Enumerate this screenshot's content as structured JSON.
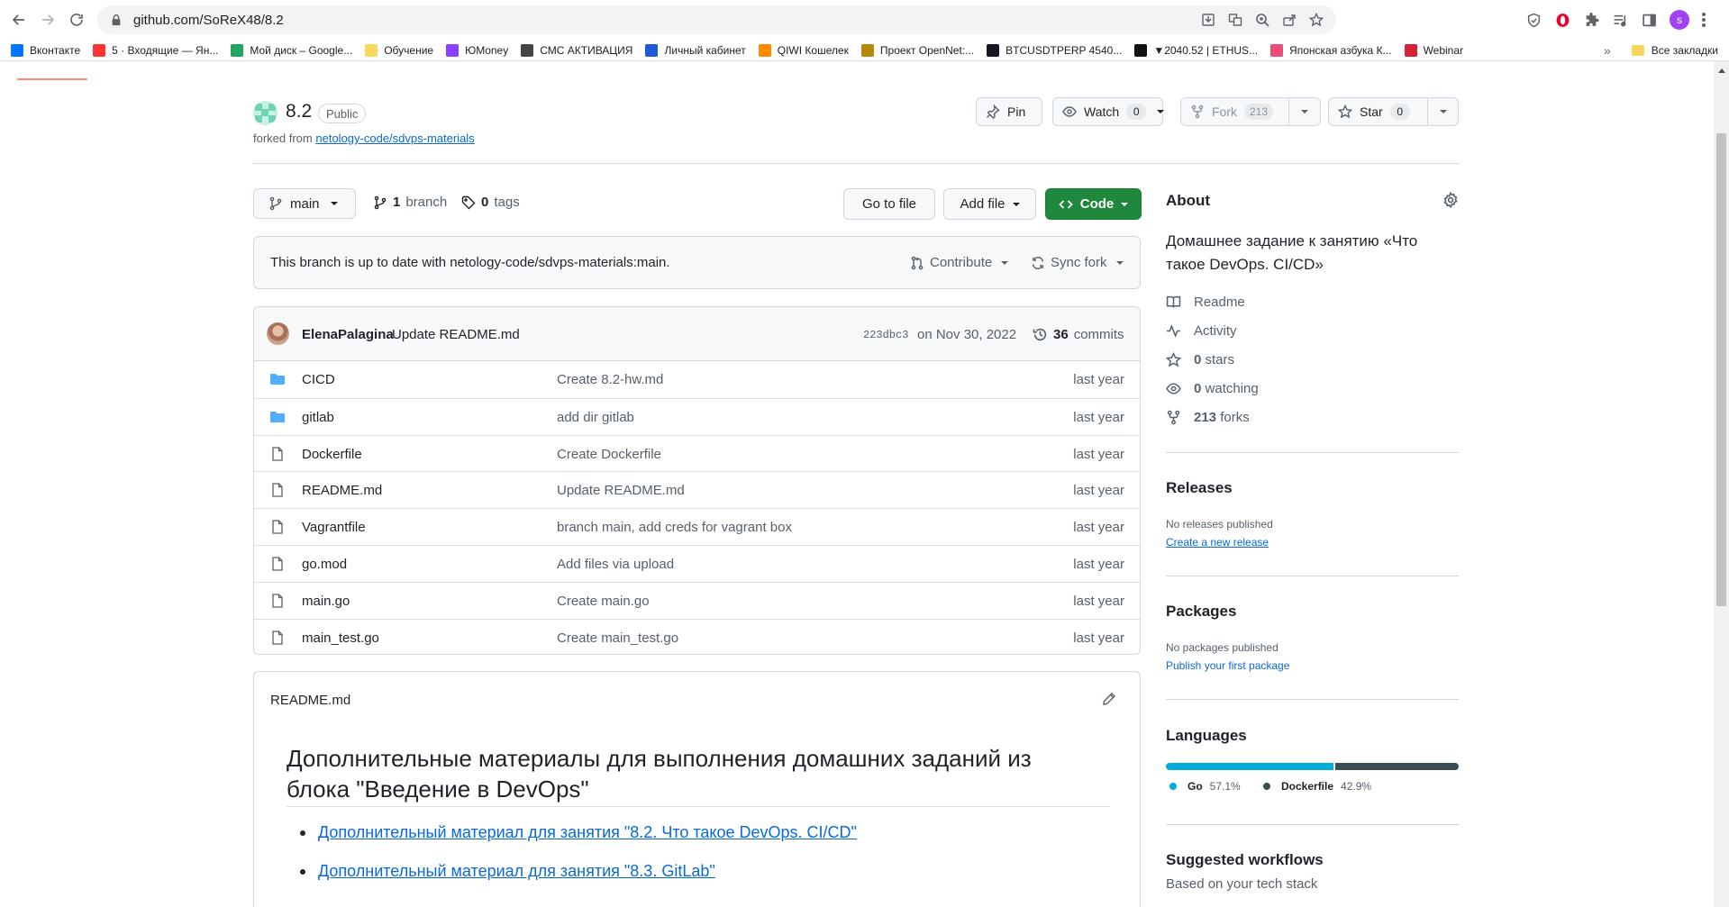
{
  "browser": {
    "url": "github.com/SoReX48/8.2",
    "profile_initial": "s",
    "bookmarks": [
      {
        "label": "Вконтакте",
        "color": "#0077ff"
      },
      {
        "label": "5 · Входящие — Ян...",
        "color": "#ff3333"
      },
      {
        "label": "Мой диск – Google...",
        "color": "#1fa463"
      },
      {
        "label": "Обучение",
        "color": "#f9d65c"
      },
      {
        "label": "ЮMoney",
        "color": "#8b3ffd"
      },
      {
        "label": "СМС АКТИВАЦИЯ",
        "color": "#444444"
      },
      {
        "label": "Личный кабинет",
        "color": "#1e5bd8"
      },
      {
        "label": "QIWI Кошелек",
        "color": "#ff8c00"
      },
      {
        "label": "Проект OpenNet:...",
        "color": "#b8860b"
      },
      {
        "label": "BTCUSDTPERP 4540...",
        "color": "#131722"
      },
      {
        "label": "▼2040.52 | ETHUS...",
        "color": "#111111"
      },
      {
        "label": "Японская азбука К...",
        "color": "#e94e77"
      },
      {
        "label": "Webinar",
        "color": "#d4203a"
      }
    ],
    "bookmarks_more": "»",
    "all_bookmarks": "Все закладки"
  },
  "repo": {
    "name": "8.2",
    "visibility": "Public",
    "forked_from_prefix": "forked from",
    "forked_from": "netology-code/sdvps-materials",
    "pin_label": "Pin",
    "watch_label": "Watch",
    "watch_count": "0",
    "fork_label": "Fork",
    "fork_count": "213",
    "star_label": "Star",
    "star_count": "0"
  },
  "filenav": {
    "branch": "main",
    "branches_count": "1",
    "branches_label": "branch",
    "tags_count": "0",
    "tags_label": "tags",
    "goto_file": "Go to file",
    "add_file": "Add file",
    "code": "Code"
  },
  "sync": {
    "message": "This branch is up to date with netology-code/sdvps-materials:main.",
    "contribute": "Contribute",
    "sync_fork": "Sync fork"
  },
  "latest_commit": {
    "author": "ElenaPalagina",
    "message": "Update README.md",
    "sha": "223dbc3",
    "date": "on Nov 30, 2022",
    "commits_count": "36",
    "commits_label": "commits"
  },
  "files": [
    {
      "name": "CICD",
      "type": "folder",
      "message": "Create 8.2-hw.md",
      "age": "last year"
    },
    {
      "name": "gitlab",
      "type": "folder",
      "message": "add dir gitlab",
      "age": "last year"
    },
    {
      "name": "Dockerfile",
      "type": "file",
      "message": "Create Dockerfile",
      "age": "last year"
    },
    {
      "name": "README.md",
      "type": "file",
      "message": "Update README.md",
      "age": "last year"
    },
    {
      "name": "Vagrantfile",
      "type": "file",
      "message": "branch main, add creds for vagrant box",
      "age": "last year"
    },
    {
      "name": "go.mod",
      "type": "file",
      "message": "Add files via upload",
      "age": "last year"
    },
    {
      "name": "main.go",
      "type": "file",
      "message": "Create main.go",
      "age": "last year"
    },
    {
      "name": "main_test.go",
      "type": "file",
      "message": "Create main_test.go",
      "age": "last year"
    }
  ],
  "readme": {
    "filename": "README.md",
    "heading": "Дополнительные материалы для выполнения домашних заданий из блока \"Введение в DevOps\"",
    "links": [
      "Дополнительный материал для занятия \"8.2. Что такое DevOps. CI/CD\"",
      "Дополнительный материал для занятия \"8.3. GitLab\""
    ]
  },
  "about": {
    "title": "About",
    "description": "Домашнее задание к занятию «Что такое DevOps. CI/CD»",
    "readme": "Readme",
    "activity": "Activity",
    "stars_count": "0",
    "stars_label": "stars",
    "watching_count": "0",
    "watching_label": "watching",
    "forks_count": "213",
    "forks_label": "forks"
  },
  "releases": {
    "title": "Releases",
    "empty": "No releases published",
    "create": "Create a new release"
  },
  "packages": {
    "title": "Packages",
    "empty": "No packages published",
    "publish": "Publish your first package"
  },
  "languages": {
    "title": "Languages",
    "items": [
      {
        "name": "Go",
        "percent": "57.1%",
        "share": 57.1,
        "color": "#00add8"
      },
      {
        "name": "Dockerfile",
        "percent": "42.9%",
        "share": 42.9,
        "color": "#384d54"
      }
    ]
  },
  "workflows": {
    "title": "Suggested workflows",
    "subtitle": "Based on your tech stack"
  }
}
